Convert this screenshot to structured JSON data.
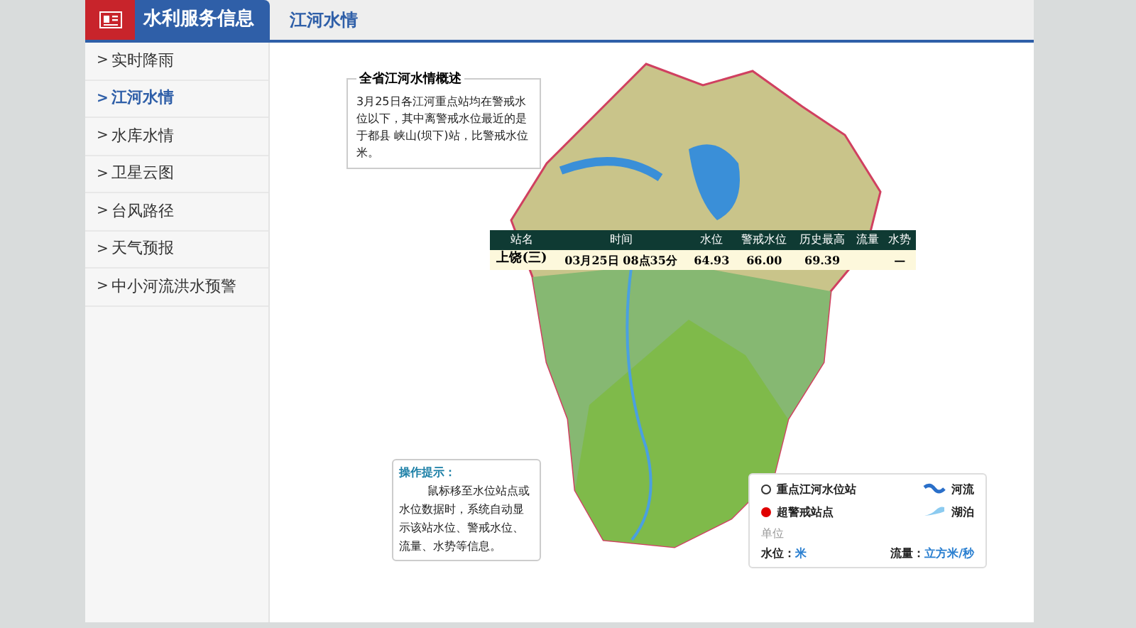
{
  "header": {
    "title": "水利服务信息",
    "tab": "江河水情"
  },
  "sidebar": {
    "items": [
      {
        "marker": ">",
        "label": "实时降雨",
        "selected": false
      },
      {
        "marker": ">",
        "label": "江河水情",
        "selected": true
      },
      {
        "marker": ">",
        "label": "水库水情",
        "selected": false
      },
      {
        "marker": ">",
        "label": "卫星云图",
        "selected": false
      },
      {
        "marker": ">",
        "label": "台风路径",
        "selected": false
      },
      {
        "marker": ">",
        "label": "天气预报",
        "selected": false
      },
      {
        "marker": ">",
        "label": "中小河流洪水预警",
        "selected": false
      }
    ]
  },
  "overview": {
    "title": "全省江河水情概述",
    "text": "3月25日各江河重点站均在警戒水位以下，其中离警戒水位最近的是于都县 峡山(坝下)站，比警戒水位米。"
  },
  "table": {
    "columns": [
      "站名",
      "时间",
      "水位",
      "警戒水位",
      "历史最高",
      "流量",
      "水势"
    ],
    "rows": [
      {
        "cells": [
          "上饶(三)",
          "03月25日 08点35分",
          "64.93",
          "66.00",
          "69.39",
          "",
          "—"
        ]
      }
    ]
  },
  "help": {
    "title": "操作提示：",
    "text": "鼠标移至水位站点或水位数据时，系统自动显示该站水位、警戒水位、流量、水势等信息。"
  },
  "legend": {
    "items": [
      {
        "kind": "station",
        "label": "重点江河水位站"
      },
      {
        "kind": "river",
        "label": "河流"
      },
      {
        "kind": "alert",
        "label": "超警戒站点"
      },
      {
        "kind": "lake",
        "label": "湖泊"
      }
    ],
    "units_title": "单位",
    "level_label": "水位：",
    "level_unit": "米",
    "flow_label": "流量：",
    "flow_unit": "立方米/秒"
  }
}
